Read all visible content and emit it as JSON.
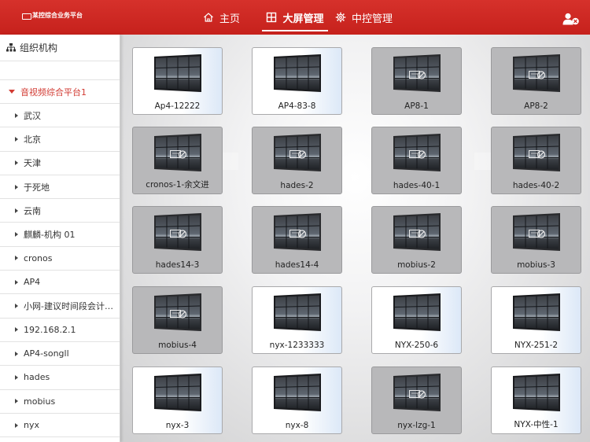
{
  "app": {
    "logo_text": "某控综合业务平台"
  },
  "nav": {
    "home_label": "主页",
    "screen_label": "大屏管理",
    "control_label": "中控管理"
  },
  "sidebar": {
    "header_label": "组织机构",
    "root_label": "音视频综合平台1",
    "items": [
      {
        "label": "武汉"
      },
      {
        "label": "北京"
      },
      {
        "label": "天津"
      },
      {
        "label": "于死地"
      },
      {
        "label": "云南"
      },
      {
        "label": "麒麟-机构 01"
      },
      {
        "label": "cronos"
      },
      {
        "label": "AP4"
      },
      {
        "label": "小网-建议时间段会计…"
      },
      {
        "label": "192.168.2.1"
      },
      {
        "label": "AP4-songll"
      },
      {
        "label": "hades"
      },
      {
        "label": "mobius"
      },
      {
        "label": "nyx"
      }
    ]
  },
  "screens": [
    {
      "name": "Ap4-12222",
      "online": true
    },
    {
      "name": "AP4-83-8",
      "online": true
    },
    {
      "name": "AP8-1",
      "online": false
    },
    {
      "name": "AP8-2",
      "online": false
    },
    {
      "name": "cronos-1-余文进",
      "online": false
    },
    {
      "name": "hades-2",
      "online": false
    },
    {
      "name": "hades-40-1",
      "online": false
    },
    {
      "name": "hades-40-2",
      "online": false
    },
    {
      "name": "hades14-3",
      "online": false
    },
    {
      "name": "hades14-4",
      "online": false
    },
    {
      "name": "mobius-2",
      "online": false
    },
    {
      "name": "mobius-3",
      "online": false
    },
    {
      "name": "mobius-4",
      "online": false
    },
    {
      "name": "nyx-1233333",
      "online": true
    },
    {
      "name": "NYX-250-6",
      "online": true
    },
    {
      "name": "NYX-251-2",
      "online": true
    },
    {
      "name": "nyx-3",
      "online": true
    },
    {
      "name": "nyx-8",
      "online": true
    },
    {
      "name": "nyx-lzg-1",
      "online": false
    },
    {
      "name": "NYX-中性-1",
      "online": true
    }
  ],
  "colors": {
    "brand": "#cc2a23",
    "active_tree": "#d23b33"
  },
  "icons": {
    "home": "home-icon",
    "screen": "grid-icon",
    "control": "gear-icon",
    "user": "user-logout-icon",
    "org": "org-tree-icon"
  }
}
